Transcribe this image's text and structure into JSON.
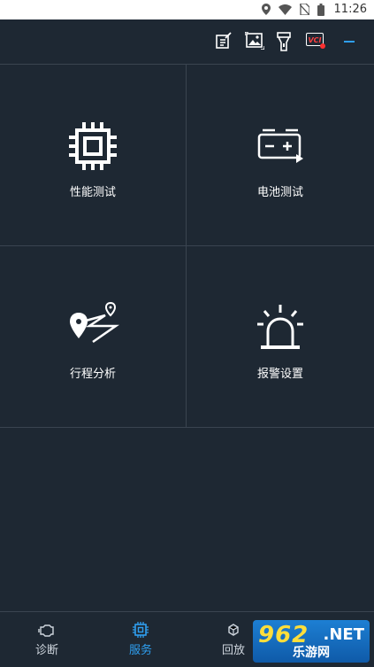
{
  "status_bar": {
    "time": "11:26",
    "icons": [
      "location-icon",
      "wifi-icon",
      "no-sim-icon",
      "battery-icon"
    ]
  },
  "toolbar": {
    "icons": [
      "edit-note-icon",
      "image-icon",
      "flashlight-icon",
      "vci-icon",
      "minimize-icon"
    ],
    "vci_label": "VCI",
    "accent_color": "#2f9ff0"
  },
  "services": [
    {
      "label": "性能测试",
      "icon": "cpu-chip-icon"
    },
    {
      "label": "电池测试",
      "icon": "battery-test-icon"
    },
    {
      "label": "行程分析",
      "icon": "route-map-icon"
    },
    {
      "label": "报警设置",
      "icon": "alarm-siren-icon"
    }
  ],
  "bottom_nav": {
    "items": [
      {
        "label": "诊断",
        "icon": "engine-icon"
      },
      {
        "label": "服务",
        "icon": "chip-icon",
        "active": true
      },
      {
        "label": "回放",
        "icon": "replay-icon"
      }
    ]
  },
  "watermark": {
    "top_text": "962",
    "net_text": ".NET",
    "sub_text": "乐游网"
  },
  "colors": {
    "background": "#1e2833",
    "divider": "#3a4450",
    "active": "#2f9ff0"
  }
}
